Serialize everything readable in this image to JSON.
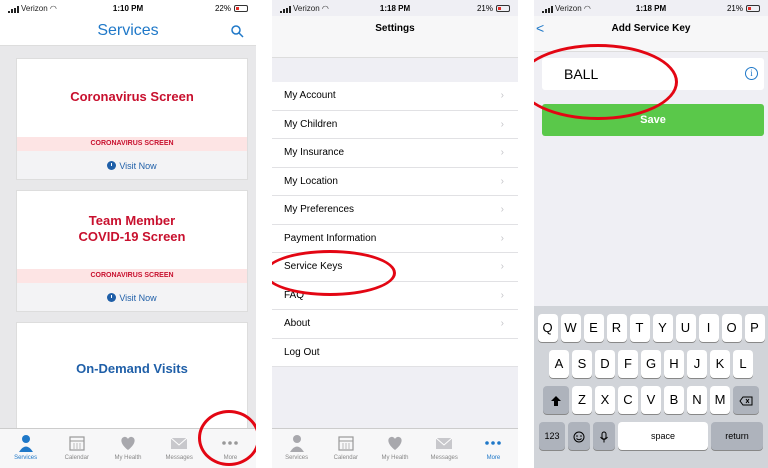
{
  "panel1": {
    "status": {
      "carrier": "Verizon",
      "time": "1:10 PM",
      "battery": "22%"
    },
    "header_title": "Services",
    "cards": [
      {
        "title": "Coronavirus Screen",
        "band": "CORONAVIRUS SCREEN",
        "link": "Visit Now"
      },
      {
        "title_line1": "Team Member",
        "title_line2": "COVID-19 Screen",
        "band": "CORONAVIRUS SCREEN",
        "link": "Visit Now"
      },
      {
        "title": "On-Demand Visits"
      }
    ],
    "tabs": [
      "Services",
      "Calendar",
      "My Health",
      "Messages",
      "More"
    ]
  },
  "panel2": {
    "status": {
      "carrier": "Verizon",
      "time": "1:18 PM",
      "battery": "21%"
    },
    "title": "Settings",
    "items": [
      "My Account",
      "My Children",
      "My Insurance",
      "My Location",
      "My Preferences",
      "Payment Information",
      "Service Keys",
      "FAQ",
      "About",
      "Log Out"
    ],
    "chevron": "›",
    "tabs": [
      "Services",
      "Calendar",
      "My Health",
      "Messages",
      "More"
    ]
  },
  "panel3": {
    "status": {
      "carrier": "Verizon",
      "time": "1:18 PM",
      "battery": "21%"
    },
    "title": "Add Service Key",
    "back": "<",
    "field_value": "BALL",
    "info": "i",
    "save_label": "Save",
    "keyboard": {
      "row1": [
        "Q",
        "W",
        "E",
        "R",
        "T",
        "Y",
        "U",
        "I",
        "O",
        "P"
      ],
      "row2": [
        "A",
        "S",
        "D",
        "F",
        "G",
        "H",
        "J",
        "K",
        "L"
      ],
      "row3": [
        "Z",
        "X",
        "C",
        "V",
        "B",
        "N",
        "M"
      ],
      "numbers": "123",
      "space": "space",
      "return": "return"
    }
  },
  "colors": {
    "accent": "#1f78c8",
    "brand_red": "#c8102e",
    "save_green": "#5ac84a",
    "highlight": "#e30613"
  }
}
